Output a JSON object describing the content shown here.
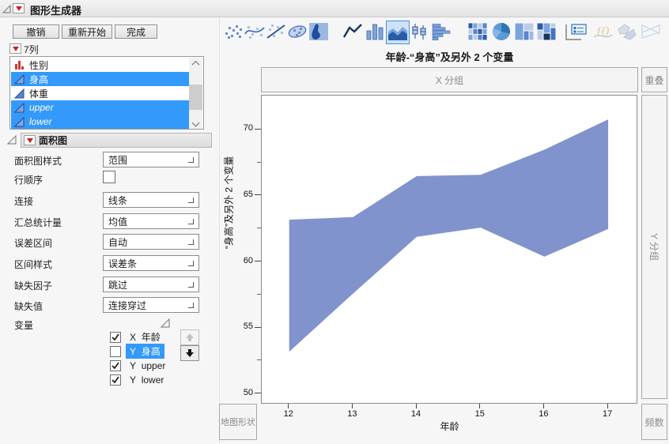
{
  "window": {
    "title": "图形生成器"
  },
  "buttons": {
    "undo": "撤销",
    "restart": "重新开始",
    "done": "完成"
  },
  "columns_panel": {
    "header": "7列",
    "items": [
      {
        "label": "性别",
        "type": "nominal",
        "selected": false,
        "italic": false
      },
      {
        "label": "身高",
        "type": "continuous",
        "selected": true,
        "italic": false
      },
      {
        "label": "体重",
        "type": "continuous",
        "selected": false,
        "italic": false
      },
      {
        "label": "upper",
        "type": "continuous",
        "selected": true,
        "italic": true
      },
      {
        "label": "lower",
        "type": "continuous",
        "selected": true,
        "italic": true
      }
    ]
  },
  "settings_panel": {
    "title": "面积图",
    "rows": [
      {
        "label": "面积图样式",
        "control": "dropdown",
        "value": "范围"
      },
      {
        "label": "行顺序",
        "control": "checkbox",
        "checked": false
      },
      {
        "label": "连接",
        "control": "dropdown",
        "value": "线条"
      },
      {
        "label": "汇总统计量",
        "control": "dropdown",
        "value": "均值"
      },
      {
        "label": "误差区间",
        "control": "dropdown",
        "value": "自动"
      },
      {
        "label": "区间样式",
        "control": "dropdown",
        "value": "误差条"
      },
      {
        "label": "缺失因子",
        "control": "dropdown",
        "value": "跳过"
      },
      {
        "label": "缺失值",
        "control": "dropdown",
        "value": "连接穿过"
      },
      {
        "label": "变量",
        "control": "disclosure"
      }
    ],
    "variables": [
      {
        "checked": true,
        "role": "X",
        "name": "年龄",
        "selected": false
      },
      {
        "checked": false,
        "role": "Y",
        "name": "身高",
        "selected": true
      },
      {
        "checked": true,
        "role": "Y",
        "name": "upper",
        "selected": false
      },
      {
        "checked": true,
        "role": "Y",
        "name": "lower",
        "selected": false
      }
    ]
  },
  "toolbar": {
    "selected": "area",
    "icons": [
      {
        "name": "points"
      },
      {
        "name": "smoother"
      },
      {
        "name": "line-of-fit"
      },
      {
        "name": "ellipse"
      },
      {
        "name": "contour"
      },
      {
        "name": "line"
      },
      {
        "name": "bar"
      },
      {
        "name": "area",
        "selected": true
      },
      {
        "name": "box-plot"
      },
      {
        "name": "histogram"
      },
      {
        "name": "heatmap"
      },
      {
        "name": "pie"
      },
      {
        "name": "treemap"
      },
      {
        "name": "mosaic"
      },
      {
        "name": "caption-box"
      },
      {
        "name": "formula",
        "disabled": true,
        "glyph": "ƒ()"
      },
      {
        "name": "map-shapes",
        "disabled": true
      },
      {
        "name": "parallel",
        "disabled": true
      }
    ]
  },
  "graph": {
    "zones": {
      "x_group": "X 分组",
      "overlay": "重叠",
      "y_group": "Y 分组",
      "freq": "频数",
      "map_shape": "地图形状"
    }
  },
  "chart_data": {
    "type": "area",
    "variant": "range-band",
    "title": "年龄-“身高”及另外 2 个变量",
    "xlabel": "年龄",
    "ylabel": "“身高”及另外 2 个变量",
    "x": [
      12,
      13,
      14,
      15,
      16,
      17
    ],
    "series": [
      {
        "name": "upper",
        "values": [
          63.2,
          63.4,
          66.5,
          66.6,
          68.5,
          70.8
        ]
      },
      {
        "name": "lower",
        "values": [
          53.2,
          57.6,
          61.9,
          62.6,
          60.4,
          62.5
        ]
      }
    ],
    "xlim": [
      11.57,
      17.47
    ],
    "ylim": [
      49.2,
      72.6
    ],
    "xticks": [
      12,
      13,
      14,
      15,
      16,
      17
    ],
    "yticks": [
      50,
      55,
      60,
      65,
      70
    ],
    "yminor": [
      52.5,
      57.5,
      62.5,
      67.5
    ],
    "fill": "#8093cc",
    "grid": false,
    "legend": "none"
  }
}
